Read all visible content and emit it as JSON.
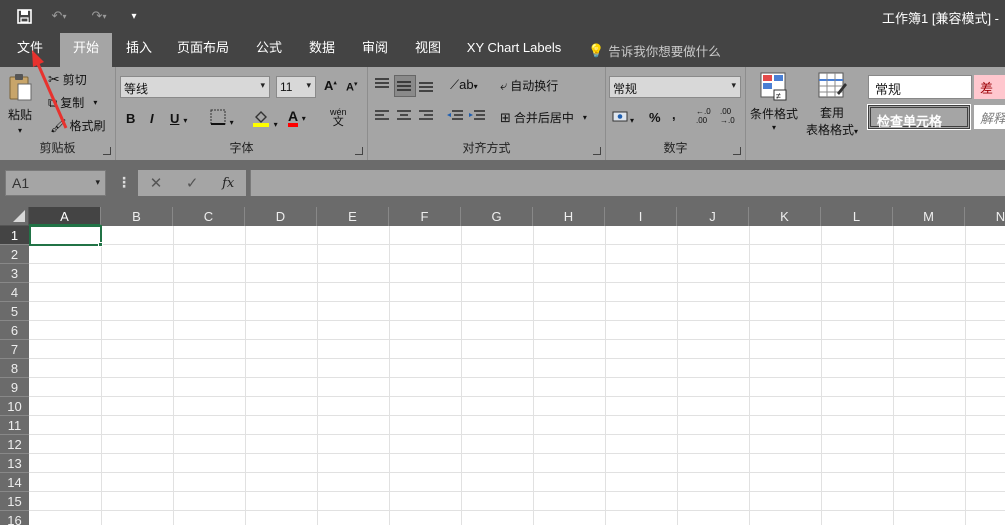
{
  "titlebar": {
    "title": "工作簿1  [兼容模式] -",
    "icons": [
      "save-icon",
      "undo-icon",
      "redo-icon",
      "customize-qat-icon"
    ]
  },
  "tabs": [
    {
      "label": "文件"
    },
    {
      "label": "开始"
    },
    {
      "label": "插入"
    },
    {
      "label": "页面布局"
    },
    {
      "label": "公式"
    },
    {
      "label": "数据"
    },
    {
      "label": "审阅"
    },
    {
      "label": "视图"
    },
    {
      "label": "XY Chart Labels"
    }
  ],
  "tell_me": "告诉我你想要做什么",
  "ribbon": {
    "clipboard": {
      "paste": "粘贴",
      "cut": "剪切",
      "copy": "复制",
      "format_painter": "格式刷",
      "label": "剪贴板"
    },
    "font": {
      "font_name": "等线",
      "font_size": "11",
      "bold": "B",
      "italic": "I",
      "underline": "U",
      "grow": "A",
      "shrink": "A",
      "wen": "wén",
      "wen_char": "文",
      "label": "字体",
      "fill_color": "#ffff00",
      "font_color": "#ff0000"
    },
    "alignment": {
      "wrap": "自动换行",
      "merge": "合并后居中",
      "label": "对齐方式"
    },
    "number": {
      "format": "常规",
      "percent": "%",
      "comma": ",",
      "inc_decimal": ".00",
      "dec_decimal": ".00",
      "label": "数字"
    },
    "styles": {
      "conditional": "条件格式",
      "table_line1": "套用",
      "table_line2": "表格格式",
      "normal": "常规",
      "bad": "差",
      "check_cell": "检查单元格",
      "explanatory": "解释"
    }
  },
  "formula_bar": {
    "name_box": "A1",
    "cancel": "✕",
    "enter": "✓",
    "fx": "fx",
    "value": ""
  },
  "grid": {
    "columns": [
      "A",
      "B",
      "C",
      "D",
      "E",
      "F",
      "G",
      "H",
      "I",
      "J",
      "K",
      "L",
      "M",
      "N"
    ],
    "rows": [
      "1",
      "2",
      "3",
      "4",
      "5",
      "6",
      "7",
      "8",
      "9",
      "10",
      "11",
      "12",
      "13",
      "14",
      "15",
      "16"
    ],
    "selected_cell": "A1"
  },
  "colors": {
    "dark_chrome": "#444444",
    "ribbon_bg": "#a5a5a5",
    "selection_green": "#217346",
    "annotation_red": "#e8322e"
  }
}
